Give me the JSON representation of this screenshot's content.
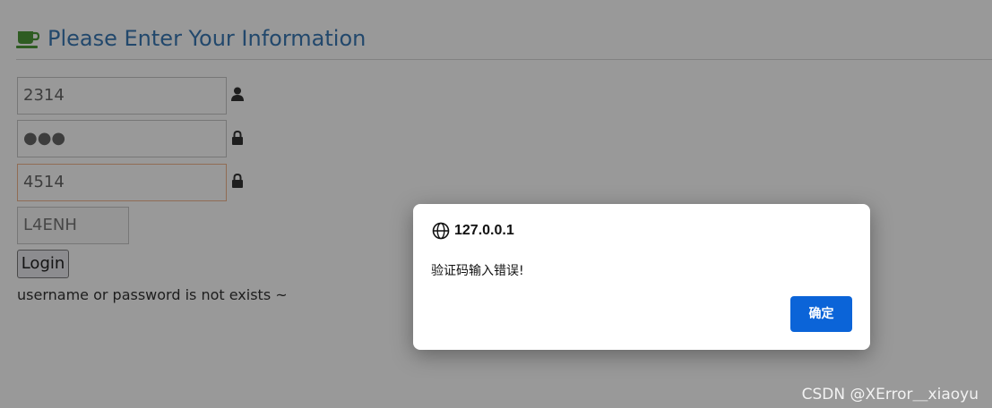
{
  "page": {
    "title": "Please Enter Your Information",
    "fields": {
      "username_value": "2314",
      "password_masked": "●●●",
      "code_value": "4514",
      "captcha_text": "L4ENH"
    },
    "login_label": "Login",
    "error_message": "username or password is not exists ~",
    "colors": {
      "heading": "#3a78b5",
      "cup": "#4e9a3a"
    }
  },
  "dialog": {
    "host": "127.0.0.1",
    "message": "验证码输入错误!",
    "ok_label": "确定",
    "colors": {
      "button": "#0b64d8"
    }
  },
  "watermark": "CSDN @XError＿xiaoyu"
}
